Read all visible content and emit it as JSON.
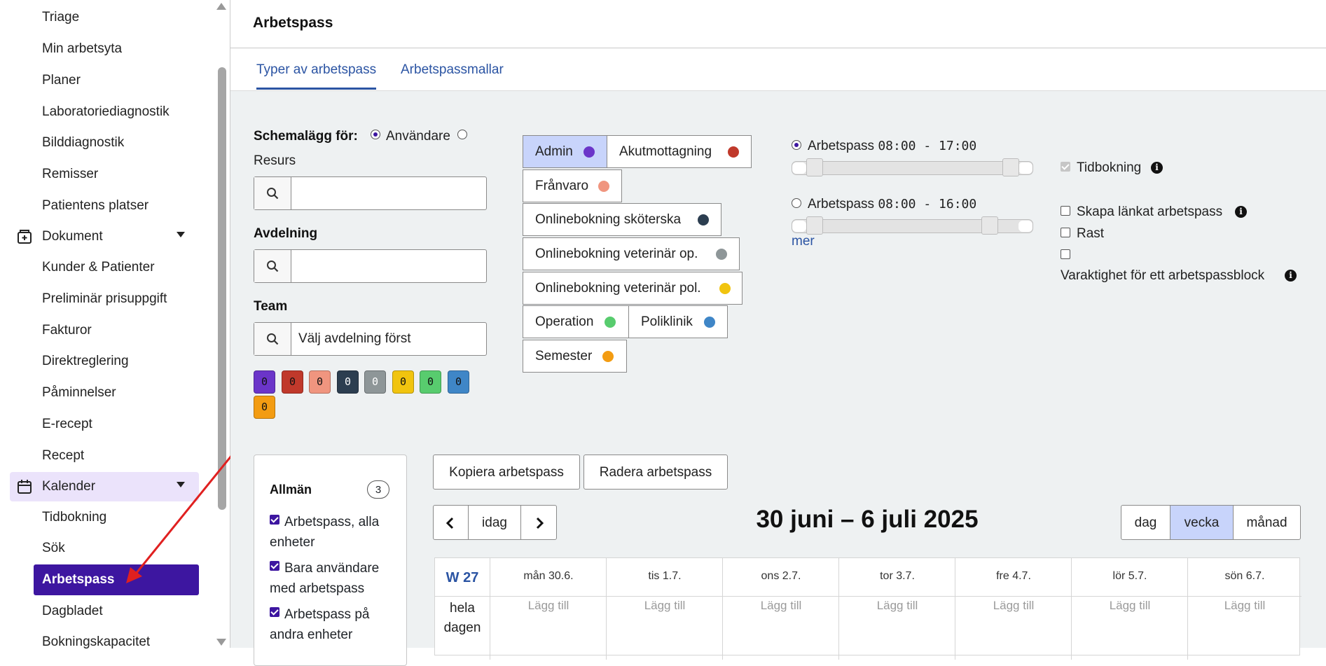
{
  "sidebar": {
    "items": [
      {
        "label": "Triage"
      },
      {
        "label": "Min arbetsyta"
      },
      {
        "label": "Planer"
      },
      {
        "label": "Laboratoriediagnostik"
      },
      {
        "label": "Bilddiagnostik"
      },
      {
        "label": "Remisser"
      },
      {
        "label": "Patientens platser"
      }
    ],
    "group_dokument": "Dokument",
    "dokument_items": [
      {
        "label": "Kunder & Patienter"
      },
      {
        "label": "Preliminär prisuppgift"
      },
      {
        "label": "Fakturor"
      },
      {
        "label": "Direktreglering"
      },
      {
        "label": "Påminnelser"
      },
      {
        "label": "E-recept"
      },
      {
        "label": "Recept"
      }
    ],
    "group_kalender": "Kalender",
    "kalender_items": [
      {
        "label": "Tidbokning"
      },
      {
        "label": "Sök"
      },
      {
        "label": "Arbetspass"
      },
      {
        "label": "Dagbladet"
      },
      {
        "label": "Bokningskapacitet"
      }
    ]
  },
  "header": {
    "title": "Arbetspass"
  },
  "tabs": [
    {
      "label": "Typer av arbetspass",
      "active": true
    },
    {
      "label": "Arbetspassmallar",
      "active": false
    }
  ],
  "filters": {
    "schedule_for_label": "Schemalägg för:",
    "option_user": "Användare",
    "option_resource": "Resurs",
    "department_label": "Avdelning",
    "department_value": "",
    "user_search_value": "",
    "team_label": "Team",
    "team_value": "Välj avdelning först"
  },
  "swatches": [
    {
      "color": "#6b35c9",
      "count": "0",
      "text": "#111"
    },
    {
      "color": "#c0392b",
      "count": "0",
      "text": "#111"
    },
    {
      "color": "#f0957f",
      "count": "0",
      "text": "#111"
    },
    {
      "color": "#2c3e50",
      "count": "0",
      "text": "#fff"
    },
    {
      "color": "#8e9698",
      "count": "0",
      "text": "#fff"
    },
    {
      "color": "#f1c40f",
      "count": "0",
      "text": "#111"
    },
    {
      "color": "#58cc6e",
      "count": "0",
      "text": "#111"
    },
    {
      "color": "#3f86c7",
      "count": "0",
      "text": "#111"
    },
    {
      "color": "#f39c12",
      "count": "0",
      "text": "#111"
    }
  ],
  "shift_types": [
    {
      "label": "Admin",
      "color": "#6b35c9",
      "selected": true
    },
    {
      "label": "Akutmottagning",
      "color": "#c0392b",
      "selected": false
    },
    {
      "label": "Frånvaro",
      "color": "#f0957f",
      "selected": false
    },
    {
      "label": "Onlinebokning sköterska",
      "color": "#2c3e50",
      "selected": false
    },
    {
      "label": "Onlinebokning veterinär op.",
      "color": "#8e9698",
      "selected": false
    },
    {
      "label": "Onlinebokning veterinär pol.",
      "color": "#f1c40f",
      "selected": false
    },
    {
      "label": "Operation",
      "color": "#58cc6e",
      "selected": false
    },
    {
      "label": "Poliklinik",
      "color": "#3f86c7",
      "selected": false
    },
    {
      "label": "Semester",
      "color": "#f39c12",
      "selected": false
    }
  ],
  "shift_options": [
    {
      "label": "Arbetspass",
      "time": "08:00 - 17:00",
      "selected": true
    },
    {
      "label": "Arbetspass",
      "time": "08:00 - 16:00",
      "selected": false
    }
  ],
  "more_link": "mer",
  "options": {
    "tidbokning": "Tidbokning",
    "linked": "Skapa länkat arbetspass",
    "rast": "Rast",
    "duration": "Varaktighet för ett arbetspassblock"
  },
  "panel": {
    "title": "Allmän",
    "count": "3",
    "items": [
      {
        "label": "Arbetspass, alla enheter",
        "checked": true
      },
      {
        "label": "Bara användare med arbetspass",
        "checked": true
      },
      {
        "label": "Arbetspass på andra enheter",
        "checked": true
      }
    ]
  },
  "actions": {
    "copy": "Kopiera arbetspass",
    "delete": "Radera arbetspass"
  },
  "calendar": {
    "today": "idag",
    "range": "30 juni – 6 juli 2025",
    "views": [
      {
        "label": "dag",
        "active": false
      },
      {
        "label": "vecka",
        "active": true
      },
      {
        "label": "månad",
        "active": false
      }
    ],
    "week": "W 27",
    "days": [
      "mån 30.6.",
      "tis 1.7.",
      "ons 2.7.",
      "tor 3.7.",
      "fre 4.7.",
      "lör 5.7.",
      "sön 6.7."
    ],
    "all_day": "hela dagen",
    "add": "Lägg till"
  },
  "accent": "#3d16a0",
  "link_color": "#2b54a3"
}
